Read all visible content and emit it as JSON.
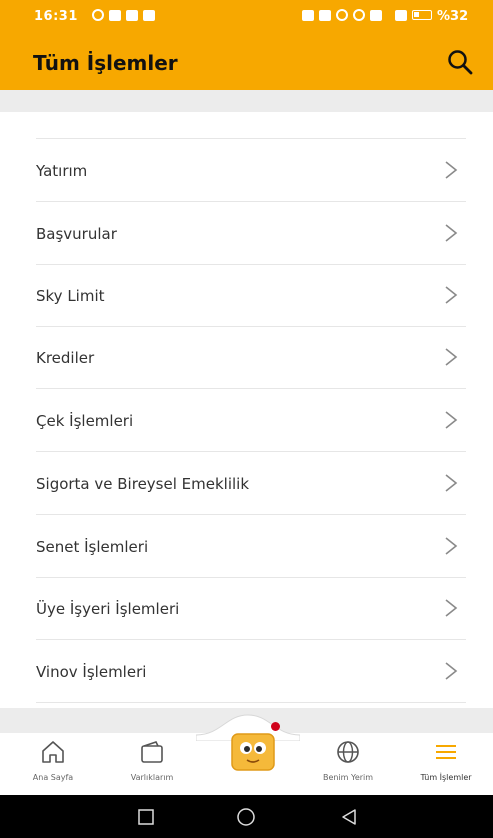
{
  "status_bar": {
    "time": "16:31",
    "battery_text": "%32",
    "left_icons": [
      "whatsapp-icon",
      "chat-bubble-icon",
      "app-icon",
      "photo-icon"
    ],
    "right_icons": [
      "nfc-icon",
      "vibrate-icon",
      "bluetooth-icon",
      "wifi-icon",
      "volte-icon",
      "signal-icon",
      "battery-icon"
    ]
  },
  "header": {
    "title": "Tüm İşlemler",
    "search_icon": "search-icon",
    "background": "#f7a800"
  },
  "menu": {
    "items": [
      {
        "label": "Yatırım"
      },
      {
        "label": "Başvurular"
      },
      {
        "label": "Sky Limit"
      },
      {
        "label": "Krediler"
      },
      {
        "label": "Çek İşlemleri"
      },
      {
        "label": "Sigorta ve Bireysel Emeklilik"
      },
      {
        "label": "Senet İşlemleri"
      },
      {
        "label": "Üye İşyeri İşlemleri"
      },
      {
        "label": "Vinov İşlemleri"
      }
    ],
    "chevron_icon": "chevron-right-icon"
  },
  "tab_bar": {
    "tabs": [
      {
        "label": "Ana Sayfa",
        "icon": "home-icon"
      },
      {
        "label": "Varlıklarım",
        "icon": "wallet-icon"
      },
      {
        "label": "Benim Yerim",
        "icon": "globe-icon"
      },
      {
        "label": "Tüm İşlemler",
        "icon": "menu-icon",
        "active": true
      }
    ],
    "center_icon": "mascot-icon",
    "accent": "#f7a800",
    "notification_color": "#d0021b"
  },
  "system_nav": {
    "buttons": [
      "recents-icon",
      "home-circle-icon",
      "back-icon"
    ]
  }
}
